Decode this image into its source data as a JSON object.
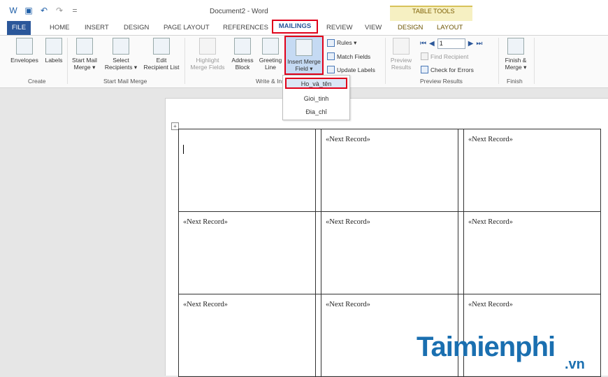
{
  "window": {
    "title": "Document2 - Word",
    "contextual_group": "TABLE TOOLS"
  },
  "qat": {
    "word_icon": "word-icon",
    "save_icon": "save-icon",
    "undo_icon": "undo-icon",
    "redo_icon": "redo-icon",
    "customize_icon": "customize-icon"
  },
  "tabs": {
    "file": "FILE",
    "home": "HOME",
    "insert": "INSERT",
    "design": "DESIGN",
    "page_layout": "PAGE LAYOUT",
    "references": "REFERENCES",
    "mailings": "MAILINGS",
    "review": "REVIEW",
    "view": "VIEW",
    "ctx_design": "DESIGN",
    "ctx_layout": "LAYOUT"
  },
  "ribbon": {
    "create": {
      "group": "Create",
      "envelopes": "Envelopes",
      "labels": "Labels"
    },
    "start_mail_merge": {
      "group": "Start Mail Merge",
      "start_l1": "Start Mail",
      "start_l2": "Merge ▾",
      "select_l1": "Select",
      "select_l2": "Recipients ▾",
      "edit_l1": "Edit",
      "edit_l2": "Recipient List"
    },
    "write_insert": {
      "group": "Write & Insert Fields",
      "highlight_l1": "Highlight",
      "highlight_l2": "Merge Fields",
      "address_l1": "Address",
      "address_l2": "Block",
      "greeting_l1": "Greeting",
      "greeting_l2": "Line",
      "insert_l1": "Insert Merge",
      "insert_l2": "Field ▾",
      "rules": "Rules ▾",
      "match_fields": "Match Fields",
      "update_labels": "Update Labels"
    },
    "preview": {
      "group": "Preview Results",
      "preview_l1": "Preview",
      "preview_l2": "Results",
      "record": "1",
      "find_recipient": "Find Recipient",
      "check_errors": "Check for Errors"
    },
    "finish": {
      "group": "Finish",
      "finish_l1": "Finish &",
      "finish_l2": "Merge ▾"
    }
  },
  "dropdown": {
    "items": [
      "Ho_và_tên",
      "Gioi_tinh",
      "Đia_chỉ"
    ]
  },
  "document": {
    "next_record": "«Next Record»"
  },
  "watermark": {
    "main": "Taimienphi",
    "suffix": ".vn"
  },
  "colors": {
    "accent": "#2b579a",
    "highlight_border": "#e0001a",
    "context_tab": "#f6f0c2",
    "watermark": "#1a6fb0"
  }
}
